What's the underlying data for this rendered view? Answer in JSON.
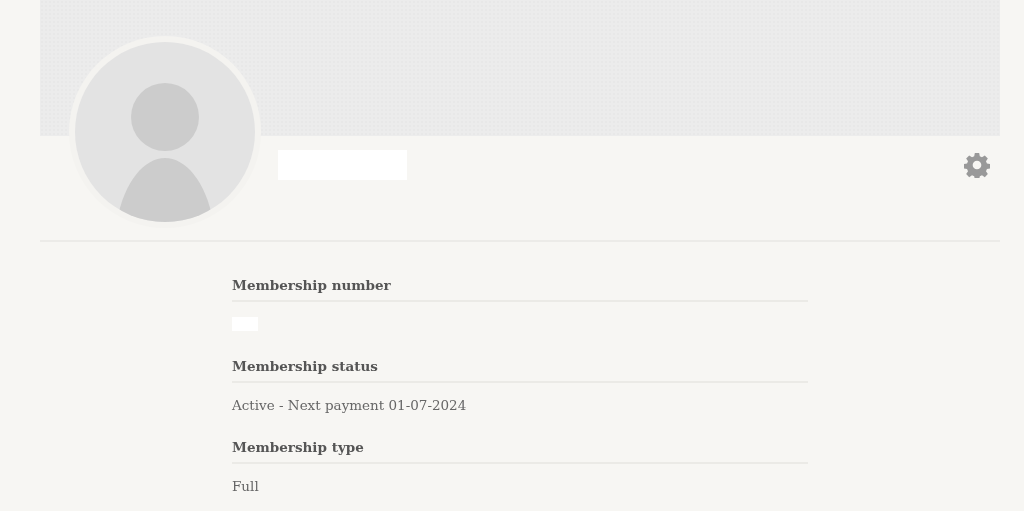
{
  "profile": {
    "name": {
      "redacted": true
    },
    "settings": {
      "kind": "gear"
    }
  },
  "fields": [
    {
      "label": "Membership number",
      "kind": "redacted"
    },
    {
      "label": "Membership status",
      "kind": "text",
      "value": "Active - Next payment 01-07-2024"
    },
    {
      "label": "Membership type",
      "kind": "text",
      "value": "Full"
    }
  ]
}
